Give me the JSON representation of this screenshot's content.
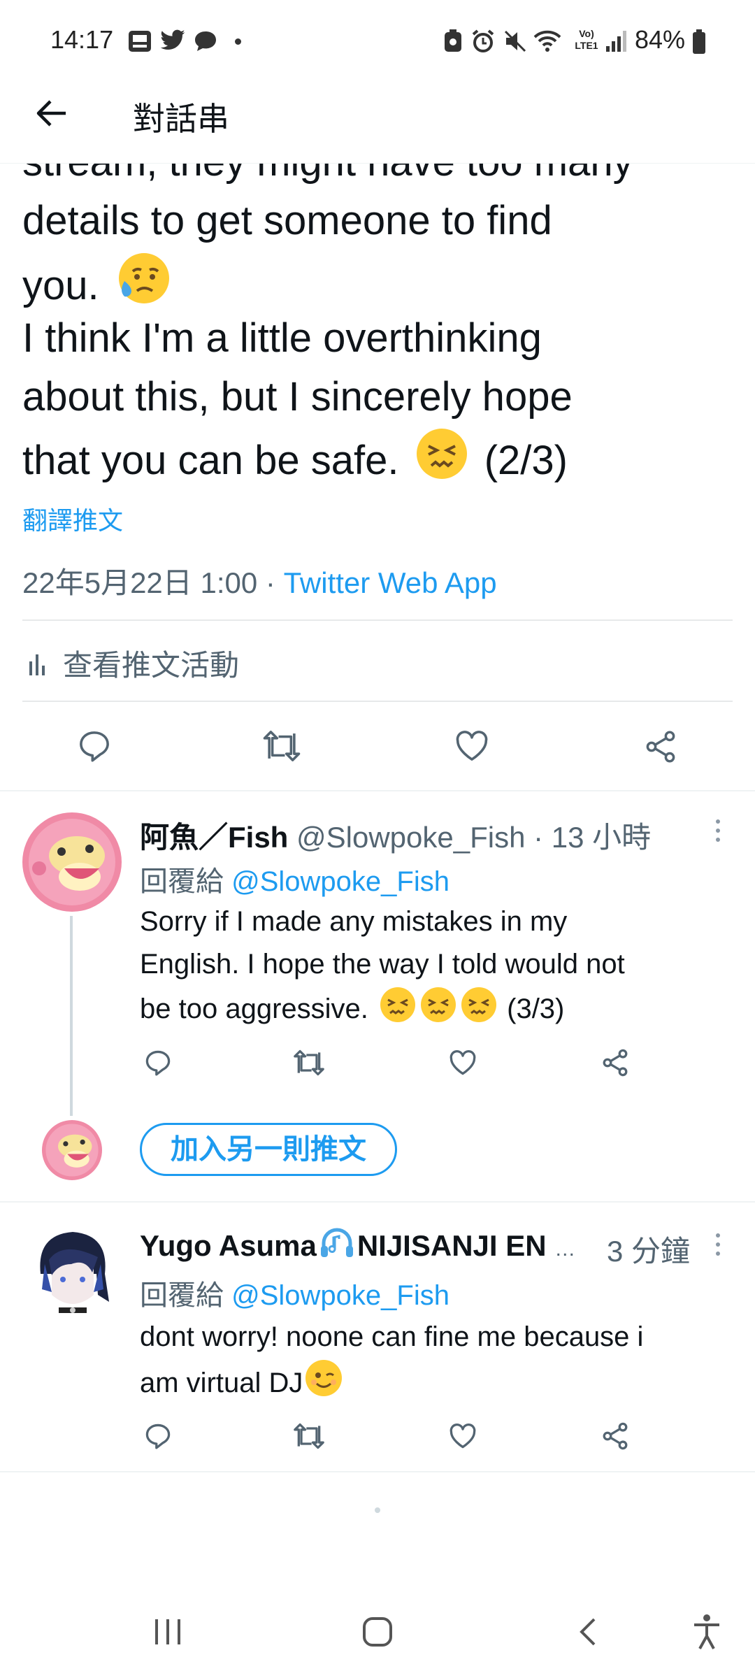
{
  "status_bar": {
    "time": "14:17",
    "network": "Vo) LTE1",
    "battery": "84%"
  },
  "header": {
    "title": "對話串"
  },
  "main_tweet": {
    "partial_line": "stream, they might have too many",
    "lines": [
      "details to get someone to find",
      "you.",
      "I think I'm a little overthinking",
      "about this, but I sincerely hope",
      "that you can be safe.",
      "(2/3)"
    ],
    "translate": "翻譯推文",
    "timestamp": "22年5月22日 1:00",
    "separator": "·",
    "source": "Twitter Web App",
    "activity": "查看推文活動"
  },
  "replies": [
    {
      "name": "阿魚／Fish",
      "handle": "@Slowpoke_Fish",
      "time": "· 13 小時",
      "reply_to_label": "回覆給",
      "reply_to_handle": "@Slowpoke_Fish",
      "lines": [
        "Sorry if I made any mistakes in my",
        "English. I hope the way I told would not",
        "be too aggressive.",
        "(3/3)"
      ]
    },
    {
      "name": "Yugo Asuma",
      "name_suffix": "NIJISANJI EN",
      "ellipsis": "…",
      "time": "3 分鐘",
      "reply_to_label": "回覆給",
      "reply_to_handle": "@Slowpoke_Fish",
      "lines": [
        "dont worry! noone can fine me because i",
        "am virtual DJ"
      ]
    }
  ],
  "add_tweet_button": "加入另一則推文",
  "colors": {
    "accent": "#1d9bf0",
    "text": "#0f1419",
    "secondary": "#536471",
    "divider": "#e7e9ea"
  },
  "icons": [
    "back-arrow-icon",
    "reply-icon",
    "retweet-icon",
    "like-icon",
    "share-icon",
    "more-icon",
    "bar-chart-icon",
    "recents-icon",
    "home-icon",
    "nav-back-icon",
    "accessibility-icon"
  ]
}
